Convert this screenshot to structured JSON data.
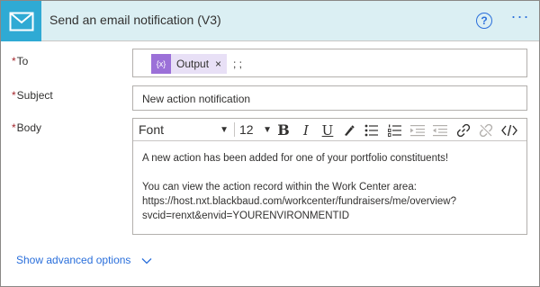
{
  "header": {
    "title": "Send an email notification (V3)",
    "help_label": "?",
    "more_label": "···"
  },
  "fields": {
    "to": {
      "required_mark": "*",
      "label": "To",
      "token": {
        "icon_label": "{x}",
        "label": "Output",
        "close_label": "×"
      },
      "suffix": "; ;"
    },
    "subject": {
      "required_mark": "*",
      "label": "Subject",
      "value": "New action notification"
    },
    "body": {
      "required_mark": "*",
      "label": "Body",
      "toolbar": {
        "font_value": "Font",
        "size_value": "12"
      },
      "lines": [
        "A new action has been added for one of your portfolio constituents!",
        "You can view the action record within the Work Center area:",
        "https://host.nxt.blackbaud.com/workcenter/fundraisers/me/overview?",
        "svcid=renxt&envid=YOURENVIRONMENTID"
      ]
    }
  },
  "footer": {
    "advanced_label": "Show advanced options"
  },
  "colors": {
    "header_bg": "#dbeff3",
    "app_icon_bg": "#2faad4",
    "link": "#2a6fdb",
    "token_bg": "#e8e0f6",
    "token_icon_bg": "#9b70d8",
    "required": "#a4262c"
  },
  "icons": {
    "app": "mail-envelope-icon",
    "help": "help-circle-icon",
    "more": "ellipsis-icon",
    "advanced": "chevron-down-icon"
  }
}
